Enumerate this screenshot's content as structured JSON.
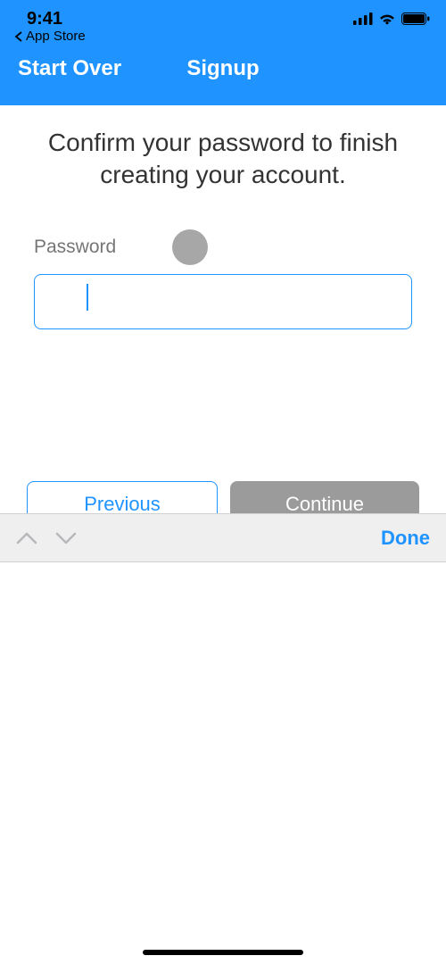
{
  "statusBar": {
    "time": "9:41",
    "backLabel": "App Store"
  },
  "nav": {
    "left": "Start Over",
    "title": "Signup"
  },
  "headline": "Confirm your password to finish creating your account.",
  "field": {
    "label": "Password",
    "value": ""
  },
  "buttons": {
    "previous": "Previous",
    "continue": "Continue"
  },
  "accessory": {
    "done": "Done"
  }
}
